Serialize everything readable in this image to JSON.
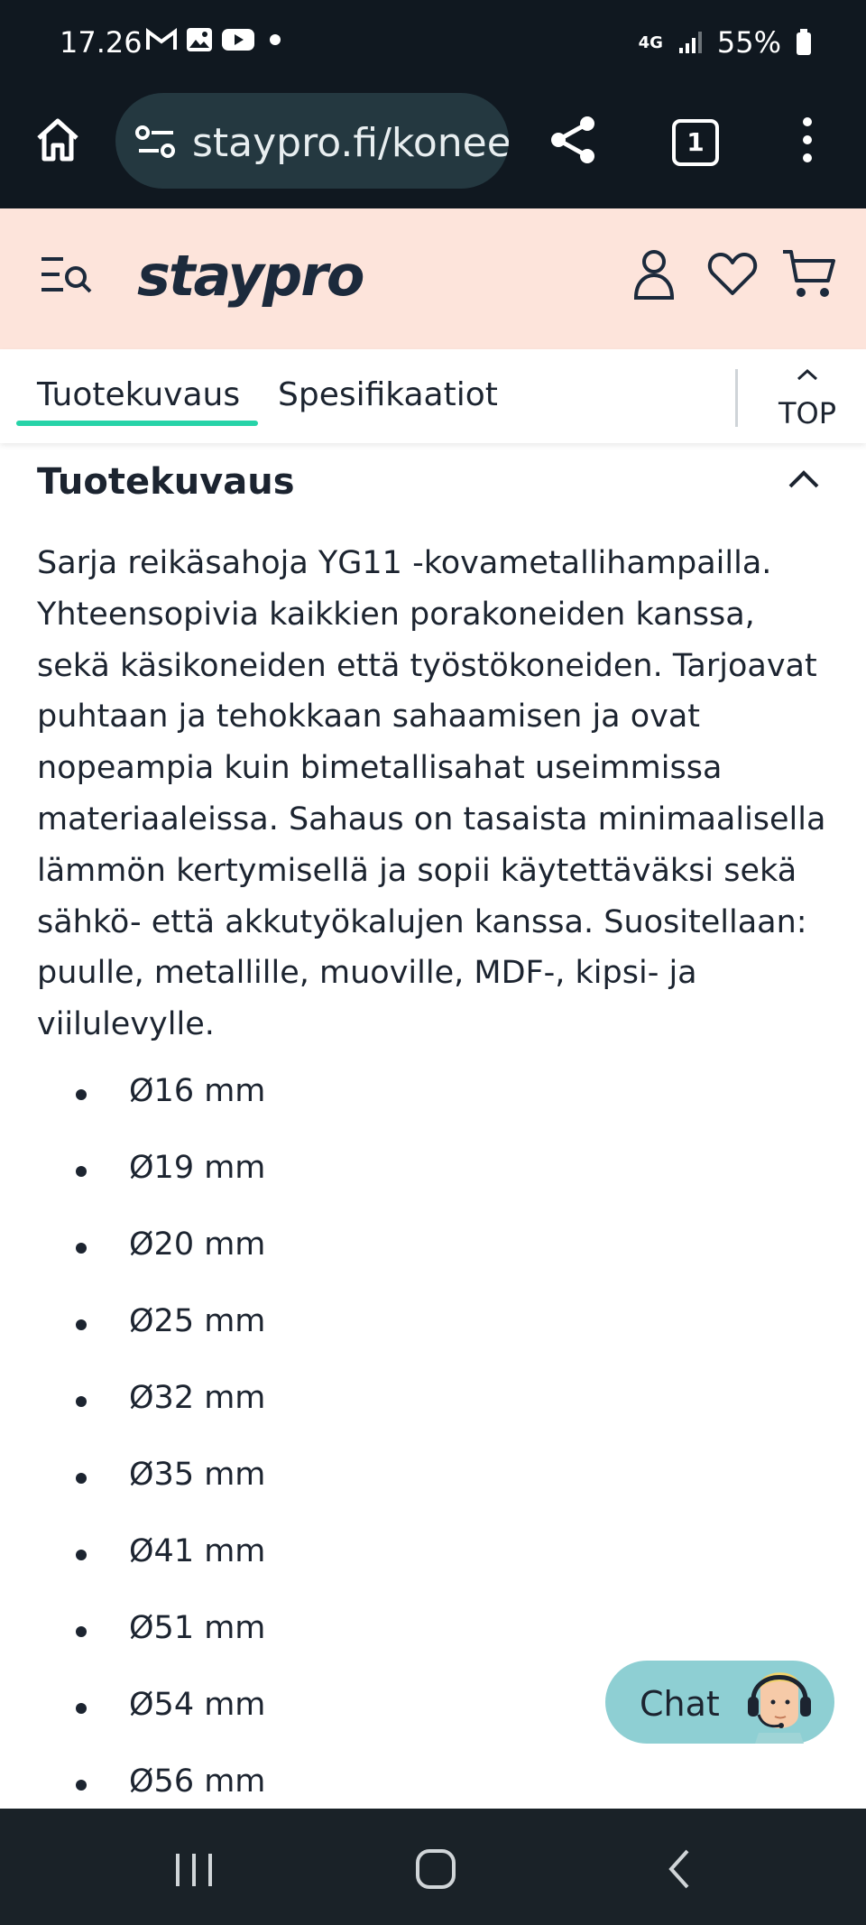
{
  "status_bar": {
    "time": "17.26",
    "notification_icons": [
      "gmail-icon",
      "gallery-icon",
      "youtube-icon",
      "dot-icon"
    ],
    "network": "4G",
    "battery": "55%"
  },
  "browser": {
    "url": "staypro.fi/koneet",
    "tab_count": "1"
  },
  "site": {
    "logo": "staypro"
  },
  "tabs": [
    {
      "label": "Tuotekuvaus",
      "active": true
    },
    {
      "label": "Spesifikaatiot",
      "active": false
    }
  ],
  "top_button": {
    "label": "TOP"
  },
  "section": {
    "heading": "Tuotekuvaus",
    "description": "Sarja reikäsahoja YG11 -kovametallihampailla. Yhteensopivia kaikkien porakoneiden kanssa, sekä käsikoneiden että työstökoneiden. Tarjoavat puhtaan ja tehokkaan sahaamisen ja ovat nopeampia kuin bimetallisahat useimmissa materiaaleissa. Sahaus on tasaista minimaalisella lämmön kertymisellä ja sopii käytettäväksi sekä sähkö- että akkutyökalujen kanssa. Suositellaan: puulle, metallille, muoville, MDF-, kipsi- ja viilulevylle.",
    "sizes": [
      "Ø16 mm",
      "Ø19 mm",
      "Ø20 mm",
      "Ø25 mm",
      "Ø32 mm",
      "Ø35 mm",
      "Ø41 mm",
      "Ø51 mm",
      "Ø54 mm",
      "Ø56 mm"
    ]
  },
  "chat": {
    "label": "Chat"
  },
  "colors": {
    "header_bg": "#fde4db",
    "accent": "#27d3a8",
    "chat_bg": "#8ecfd3",
    "chrome_bg": "#101820"
  }
}
